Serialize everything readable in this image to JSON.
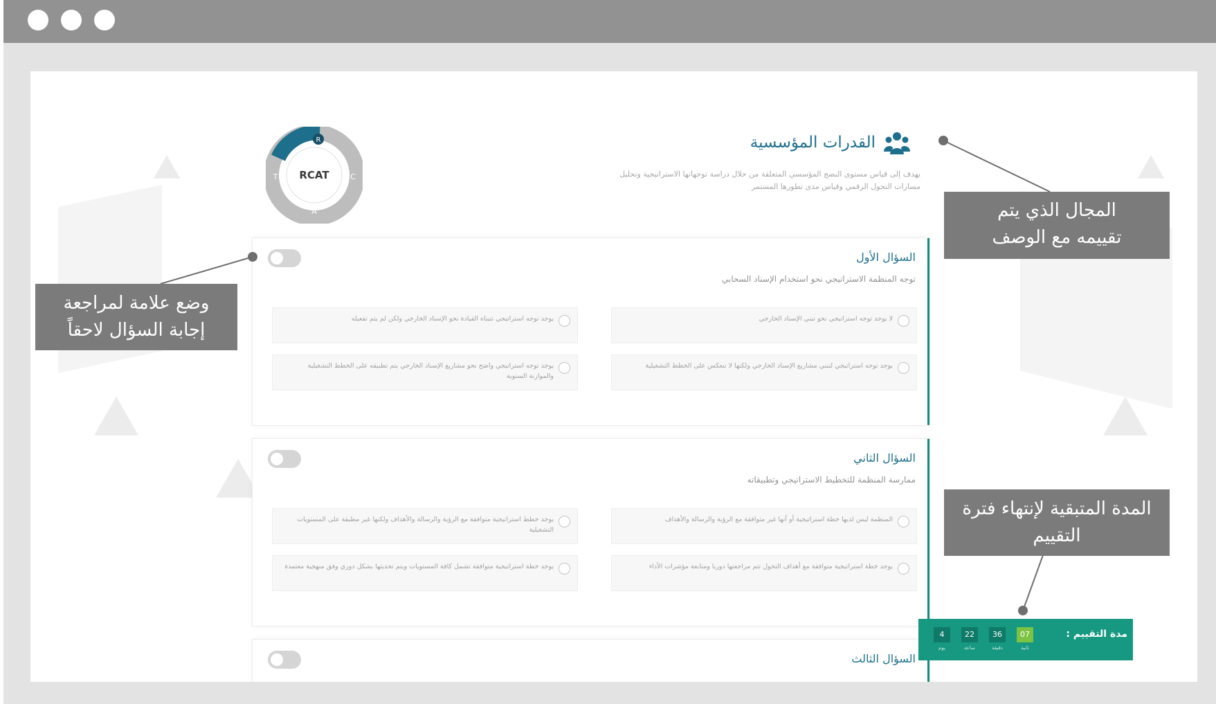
{
  "domain": {
    "title": "القدرات المؤسسية",
    "description": "يهدف إلى قياس مستوى النضج المؤسسي المتعلقة من خلال دراسة توجهاتها الاستراتيجية وتحليل مسارات التحول الرقمي وقياس مدى تطورها المستمر",
    "icon": "people-group-icon"
  },
  "logo": {
    "text": "RCAT",
    "letters": [
      "R",
      "C",
      "A",
      "T"
    ]
  },
  "questions": [
    {
      "title": "السؤال الأول",
      "text": "توجه المنظمة الاستراتيجي نحو استخدام الإسناد السحابي",
      "options": [
        "لا يوجد توجه استراتيجي نحو تبني الإسناد الخارجي",
        "يوجد توجه استراتيجي تتبناه القيادة نحو الإسناد الخارجي ولكن لم يتم تفعيله",
        "يوجد توجه استراتيجي لتبني مشاريع الإسناد الخارجي ولكنها لا تنعكس على الخطط التشغيلية",
        "يوجد توجه استراتيجي واضح نحو مشاريع الإسناد الخارجي يتم تطبيقه على الخطط التشغيلية والموازنة السنوية"
      ]
    },
    {
      "title": "السؤال الثاني",
      "text": "ممارسة المنظمة للتخطيط الاستراتيجي وتطبيقاته",
      "options": [
        "المنظمة ليس لديها خطة استراتيجية أو أنها غير متوافقة مع الرؤية والرسالة والأهداف",
        "يوجد خطط استراتيجية متوافقة مع الرؤية والرسالة والأهداف ولكنها غير مطبقة على المستويات التشغيلية",
        "يوجد خطة استراتيجية متوافقة مع أهداف التحول تتم مراجعتها دوريا ومتابعة مؤشرات الأداء",
        "يوجد خطة استراتيجية متوافقة تشمل كافة المستويات ويتم تحديثها بشكل دوري وفق منهجية معتمدة"
      ]
    },
    {
      "title": "السؤال الثالث"
    }
  ],
  "timer": {
    "label": "مدة التقييم :",
    "days": "4",
    "days_unit": "يوم",
    "hours": "22",
    "hours_unit": "ساعة",
    "minutes": "36",
    "minutes_unit": "دقيقة",
    "seconds": "07",
    "seconds_unit": "ثانية"
  },
  "callouts": {
    "domain": "المجال الذي يتم تقييمه مع الوصف",
    "flag": "وضع علامة لمراجعة إجابة السؤال لاحقاً",
    "timer": "المدة المتبقية لإنتهاء فترة التقييم"
  },
  "colors": {
    "accent": "#1b8a7c",
    "title": "#1e6f8c",
    "timer_bg": "#179880",
    "timer_highlight": "#7cc243",
    "callout_bg": "#7b7b7b"
  }
}
